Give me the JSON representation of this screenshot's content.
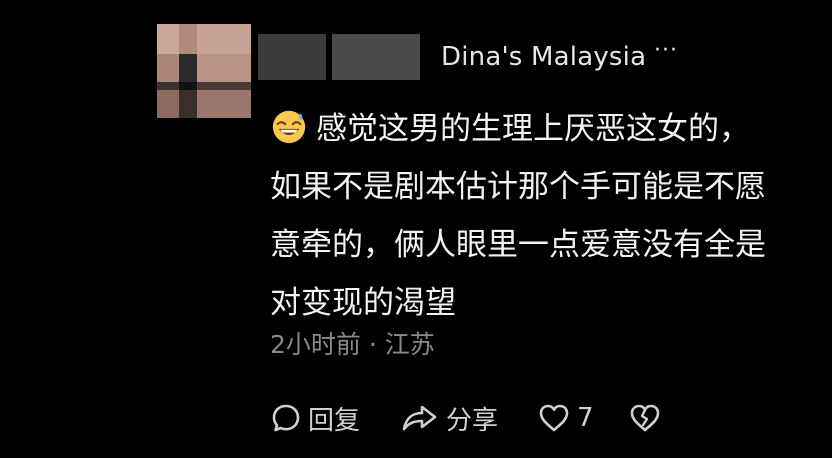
{
  "comment": {
    "author": {
      "avatar": "pixelated-avatar",
      "name_redacted": true,
      "name_suffix": "Dina's Malaysia",
      "more_label": "···"
    },
    "emoji": "grinning-face-with-sweat-icon",
    "lines": [
      "感觉这男的生理上厌恶这女的，",
      "如果不是剧本估计那个手可能是不愿",
      "意牵的，俩人眼里一点爱意没有全是",
      "对变现的渴望"
    ],
    "meta": "2小时前 · 江苏",
    "actions": {
      "reply_label": "回复",
      "share_label": "分享",
      "like_count": "7"
    }
  },
  "colors": {
    "background": "#000000",
    "text_primary": "#f2f2f2",
    "text_secondary": "#8a8a8a",
    "icon": "#d0d0d0"
  }
}
